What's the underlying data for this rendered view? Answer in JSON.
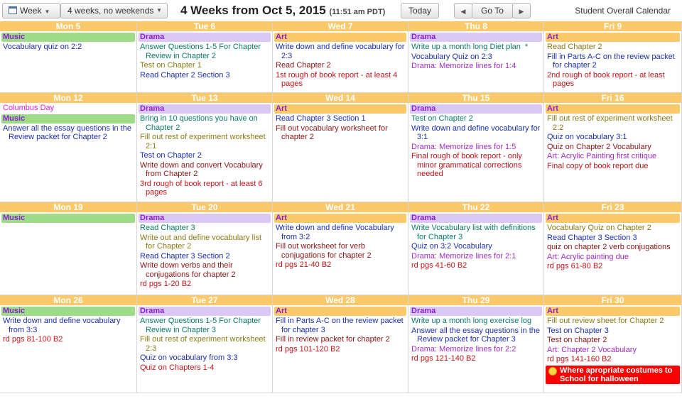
{
  "toolbar": {
    "view_label": "Week",
    "range_label": "4 weeks, no weekends",
    "title": "4 Weeks from Oct 5, 2015",
    "time": "(11:51 am PDT)",
    "today_label": "Today",
    "prev_glyph": "◀",
    "goto_label": "Go To",
    "next_glyph": "▶",
    "calendar_name": "Student Overall Calendar"
  },
  "colors": {
    "header_bg": "#fbc96a",
    "music_bg": "#9fdc88",
    "drama_bg": "#dcc8f4",
    "art_bg": "#fbc96a",
    "alert_bg": "#ff0000"
  },
  "weeks": [
    {
      "days": [
        {
          "label": "Mon 5",
          "items": [
            {
              "kind": "cat",
              "cls": "music",
              "text": "Music"
            },
            {
              "kind": "ev",
              "cls": "blue",
              "text": "Vocabulary quiz on 2:2"
            }
          ]
        },
        {
          "label": "Tue 6",
          "items": [
            {
              "kind": "cat",
              "cls": "drama",
              "text": "Drama"
            },
            {
              "kind": "ev",
              "cls": "teal",
              "text": "Answer Questions 1-5 For Chapter Review in Chapter 2"
            },
            {
              "kind": "ev",
              "cls": "olive",
              "text": "Test on Chapter 1"
            },
            {
              "kind": "ev",
              "cls": "blue",
              "text": "Read Chapter 2 Section 3"
            }
          ]
        },
        {
          "label": "Wed 7",
          "items": [
            {
              "kind": "cat",
              "cls": "art",
              "text": "Art"
            },
            {
              "kind": "ev",
              "cls": "blue",
              "text": "Write down and define vocabulary for 2:3"
            },
            {
              "kind": "ev",
              "cls": "dark",
              "text": "Read Chapter 2"
            },
            {
              "kind": "ev",
              "cls": "red",
              "text": "1st rough of book report - at least 4 pages"
            }
          ]
        },
        {
          "label": "Thu 8",
          "items": [
            {
              "kind": "cat",
              "cls": "drama",
              "text": "Drama"
            },
            {
              "kind": "ev",
              "cls": "teal",
              "text": "Write up a month long Diet plan",
              "star": "*"
            },
            {
              "kind": "ev",
              "cls": "blue",
              "text": "Vocabulary Quiz on 2:3"
            },
            {
              "kind": "ev",
              "cls": "purple",
              "text": "Drama: Memorize lines for 1:4"
            }
          ]
        },
        {
          "label": "Fri 9",
          "items": [
            {
              "kind": "cat",
              "cls": "art",
              "text": "Art"
            },
            {
              "kind": "ev",
              "cls": "olive",
              "text": "Read Chapter 2"
            },
            {
              "kind": "ev",
              "cls": "blue",
              "text": "Fill in Parts A-C on the review packet for chapter 2"
            },
            {
              "kind": "ev",
              "cls": "red",
              "text": "2nd rough of book report - at least pages"
            }
          ]
        }
      ]
    },
    {
      "days": [
        {
          "label": "Mon 12",
          "items": [
            {
              "kind": "ev",
              "cls": "magenta",
              "text": "Columbus Day"
            },
            {
              "kind": "cat",
              "cls": "music",
              "text": "Music"
            },
            {
              "kind": "ev",
              "cls": "blue",
              "text": "Answer all the essay questions in the Review packet for Chapter 2"
            }
          ]
        },
        {
          "label": "Tue 13",
          "items": [
            {
              "kind": "cat",
              "cls": "drama",
              "text": "Drama"
            },
            {
              "kind": "ev",
              "cls": "teal",
              "text": "Bring in 10 questions you have on Chapter 2"
            },
            {
              "kind": "ev",
              "cls": "olive",
              "text": "Fill out rest of experiment worksheet 2:1"
            },
            {
              "kind": "ev",
              "cls": "blue",
              "text": "Test on Chapter 2"
            },
            {
              "kind": "ev",
              "cls": "dark",
              "text": "Write down and convert Vocabulary from Chapter 2"
            },
            {
              "kind": "ev",
              "cls": "red",
              "text": "3rd rough of book report - at least 6 pages"
            }
          ]
        },
        {
          "label": "Wed 14",
          "items": [
            {
              "kind": "cat",
              "cls": "art",
              "text": "Art"
            },
            {
              "kind": "ev",
              "cls": "blue",
              "text": "Read Chapter 3 Section 1"
            },
            {
              "kind": "ev",
              "cls": "dark",
              "text": "Fill out vocabulary worksheet for chapter 2"
            }
          ]
        },
        {
          "label": "Thu 15",
          "items": [
            {
              "kind": "cat",
              "cls": "drama",
              "text": "Drama"
            },
            {
              "kind": "ev",
              "cls": "teal",
              "text": "Test on Chapter 2"
            },
            {
              "kind": "ev",
              "cls": "blue",
              "text": "Write down and define vocabulary for 3:1"
            },
            {
              "kind": "ev",
              "cls": "purple",
              "text": "Drama: Memorize lines for 1:5"
            },
            {
              "kind": "ev",
              "cls": "red",
              "text": "Final rough of book report - only minor grammatical corrections needed"
            }
          ]
        },
        {
          "label": "Fri 16",
          "items": [
            {
              "kind": "cat",
              "cls": "art",
              "text": "Art"
            },
            {
              "kind": "ev",
              "cls": "olive",
              "text": "Fill out rest of experiment worksheet 2:2"
            },
            {
              "kind": "ev",
              "cls": "blue",
              "text": "Quiz on vocabulary 3:1"
            },
            {
              "kind": "ev",
              "cls": "dark",
              "text": "Quiz on Chapter 2 Vocabulary"
            },
            {
              "kind": "ev",
              "cls": "purple",
              "text": "Art: Acrylic Painting first critique"
            },
            {
              "kind": "ev",
              "cls": "red",
              "text": "Final copy of book report due"
            }
          ]
        }
      ]
    },
    {
      "days": [
        {
          "label": "Mon 19",
          "items": [
            {
              "kind": "cat",
              "cls": "music",
              "text": "Music"
            }
          ]
        },
        {
          "label": "Tue 20",
          "items": [
            {
              "kind": "cat",
              "cls": "drama",
              "text": "Drama"
            },
            {
              "kind": "ev",
              "cls": "teal",
              "text": "Read Chapter 3"
            },
            {
              "kind": "ev",
              "cls": "olive",
              "text": "Write out and define vocabulary list for Chapter 2"
            },
            {
              "kind": "ev",
              "cls": "blue",
              "text": "Read Chapter 3 Section 2"
            },
            {
              "kind": "ev",
              "cls": "dark",
              "text": "Write down verbs and their conjugations for chapter 2"
            },
            {
              "kind": "ev",
              "cls": "red",
              "text": "rd pgs 1-20 B2"
            }
          ]
        },
        {
          "label": "Wed 21",
          "items": [
            {
              "kind": "cat",
              "cls": "art",
              "text": "Art"
            },
            {
              "kind": "ev",
              "cls": "blue",
              "text": "Write down and define Vocabulary from 3:2"
            },
            {
              "kind": "ev",
              "cls": "dark",
              "text": "Fill out worksheet for verb conjugations for chapter 2"
            },
            {
              "kind": "ev",
              "cls": "red",
              "text": "rd pgs 21-40 B2"
            }
          ]
        },
        {
          "label": "Thu 22",
          "items": [
            {
              "kind": "cat",
              "cls": "drama",
              "text": "Drama"
            },
            {
              "kind": "ev",
              "cls": "teal",
              "text": "Write Vocabulary list with definitions for Chapter 3"
            },
            {
              "kind": "ev",
              "cls": "blue",
              "text": "Quiz on 3:2 Vocabulary"
            },
            {
              "kind": "ev",
              "cls": "purple",
              "text": "Drama: Memorize lines for 2:1"
            },
            {
              "kind": "ev",
              "cls": "red",
              "text": "rd pgs 41-60 B2"
            }
          ]
        },
        {
          "label": "Fri 23",
          "items": [
            {
              "kind": "cat",
              "cls": "art",
              "text": "Art"
            },
            {
              "kind": "ev",
              "cls": "olive",
              "text": "Vocabulary Quiz on Chapter 2"
            },
            {
              "kind": "ev",
              "cls": "blue",
              "text": "Read Chapter 3 Section 3"
            },
            {
              "kind": "ev",
              "cls": "dark",
              "text": "quiz on chapter 2 verb conjugations"
            },
            {
              "kind": "ev",
              "cls": "purple",
              "text": "Art: Acrylic painting due"
            },
            {
              "kind": "ev",
              "cls": "red",
              "text": "rd pgs 61-80 B2"
            }
          ]
        }
      ]
    },
    {
      "days": [
        {
          "label": "Mon 26",
          "items": [
            {
              "kind": "cat",
              "cls": "music",
              "text": "Music"
            },
            {
              "kind": "ev",
              "cls": "blue",
              "text": "Write down and define vocabulary from 3:3"
            },
            {
              "kind": "ev",
              "cls": "red",
              "text": "rd pgs 81-100 B2"
            }
          ]
        },
        {
          "label": "Tue 27",
          "items": [
            {
              "kind": "cat",
              "cls": "drama",
              "text": "Drama"
            },
            {
              "kind": "ev",
              "cls": "teal",
              "text": "Answer Questions 1-5 For Chapter Review in Chapter 3"
            },
            {
              "kind": "ev",
              "cls": "olive",
              "text": "Fill out rest of experiment worksheet 2:3"
            },
            {
              "kind": "ev",
              "cls": "blue",
              "text": "Quiz on vocabulary from 3:3"
            },
            {
              "kind": "ev",
              "cls": "red",
              "text": "Quiz on Chapters 1-4"
            }
          ]
        },
        {
          "label": "Wed 28",
          "items": [
            {
              "kind": "cat",
              "cls": "art",
              "text": "Art"
            },
            {
              "kind": "ev",
              "cls": "blue",
              "text": "Fill in Parts A-C on the review packet for chapter 3"
            },
            {
              "kind": "ev",
              "cls": "dark",
              "text": "Fill in review packet for chapter 2"
            },
            {
              "kind": "ev",
              "cls": "red",
              "text": "rd pgs 101-120 B2"
            }
          ]
        },
        {
          "label": "Thu 29",
          "items": [
            {
              "kind": "cat",
              "cls": "drama",
              "text": "Drama"
            },
            {
              "kind": "ev",
              "cls": "teal",
              "text": "Write up a month long exercise log"
            },
            {
              "kind": "ev",
              "cls": "blue",
              "text": "Answer all the essay questions in the Review packet for Chapter 3"
            },
            {
              "kind": "ev",
              "cls": "purple",
              "text": "Drama: Memorize lines for 2:2"
            },
            {
              "kind": "ev",
              "cls": "red",
              "text": "rd pgs 121-140 B2"
            }
          ]
        },
        {
          "label": "Fri 30",
          "items": [
            {
              "kind": "cat",
              "cls": "art",
              "text": "Art"
            },
            {
              "kind": "ev",
              "cls": "olive",
              "text": "Fill out review sheet for Chapter 2"
            },
            {
              "kind": "ev",
              "cls": "blue",
              "text": "Test on Chapter 3"
            },
            {
              "kind": "ev",
              "cls": "dark",
              "text": "Test on chapter 2"
            },
            {
              "kind": "ev",
              "cls": "purple",
              "text": "Art: Chapter 2 Vocabulary"
            },
            {
              "kind": "ev",
              "cls": "red",
              "text": "rd pgs 141-160 B2"
            },
            {
              "kind": "alert",
              "cls": "alert",
              "text": "Where apropriate costumes to School for halloween"
            }
          ]
        }
      ]
    }
  ]
}
